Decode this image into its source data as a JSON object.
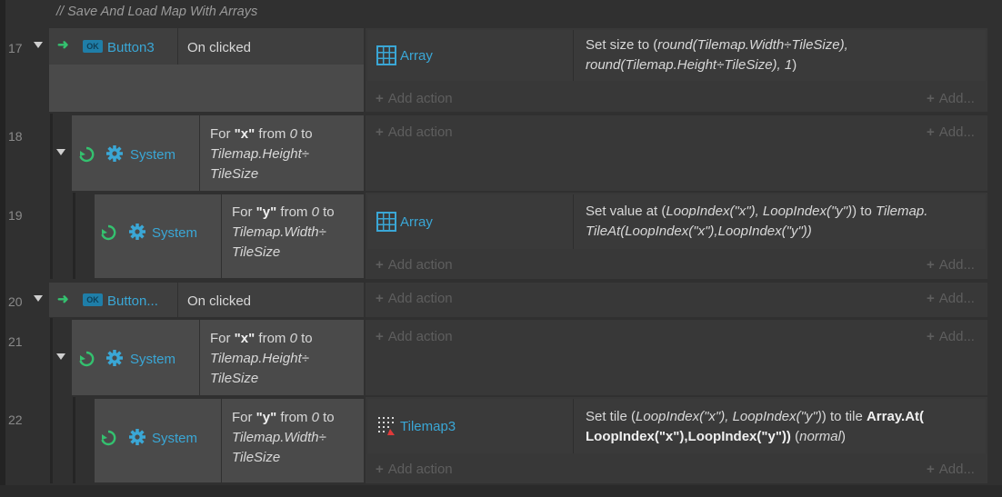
{
  "comment": "//  Save And Load Map With Arrays",
  "add_action": "Add action",
  "add_short": "Add...",
  "events": {
    "e17": {
      "line": "17",
      "condition": {
        "object": "Button3",
        "text": "On clicked"
      },
      "action": {
        "object": "Array",
        "pre": "Set size to (",
        "expr": "round(Tilemap.Width÷TileSize), round(Tilemap.Height÷TileSize), 1",
        "post": ")"
      }
    },
    "e18": {
      "line": "18",
      "condition": {
        "object": "System",
        "p1": "For ",
        "var": "\"x\"",
        "p2": " from ",
        "from": "0",
        "p3": " to",
        "to1": "Tilemap.Height÷",
        "to2": "TileSize"
      }
    },
    "e19": {
      "line": "19",
      "condition": {
        "object": "System",
        "p1": "For ",
        "var": "\"y\"",
        "p2": " from ",
        "from": "0",
        "p3": " to",
        "to1": "Tilemap.Width÷",
        "to2": "TileSize"
      },
      "action": {
        "object": "Array",
        "pre": "Set value at (",
        "args": "LoopIndex(\"x\"), LoopIndex(\"y\")",
        "mid": ") to ",
        "val1": "Tilemap.",
        "val2": "TileAt(LoopIndex(\"x\"),LoopIndex(\"y\"))"
      }
    },
    "e20": {
      "line": "20",
      "condition": {
        "object": "Button...",
        "text": "On clicked"
      }
    },
    "e21": {
      "line": "21",
      "condition": {
        "object": "System",
        "p1": "For ",
        "var": "\"x\"",
        "p2": " from ",
        "from": "0",
        "p3": " to",
        "to1": "Tilemap.Height÷",
        "to2": "TileSize"
      }
    },
    "e22": {
      "line": "22",
      "condition": {
        "object": "System",
        "p1": "For ",
        "var": "\"y\"",
        "p2": " from ",
        "from": "0",
        "p3": " to",
        "to1": "Tilemap.Width÷",
        "to2": "TileSize"
      },
      "action": {
        "object": "Tilemap3",
        "pre": "Set tile (",
        "args": "LoopIndex(\"x\"), LoopIndex(\"y\")",
        "mid": ") to tile ",
        "b1": "Array.At(",
        "b2": "LoopIndex(\"x\"),LoopIndex(\"y\"))",
        "post_pre": " (",
        "mode": "normal",
        "post": ")"
      }
    }
  },
  "colors": {
    "object_link": "#3aa7d6",
    "trigger_arrow": "#34c16f",
    "background": "#303030"
  }
}
